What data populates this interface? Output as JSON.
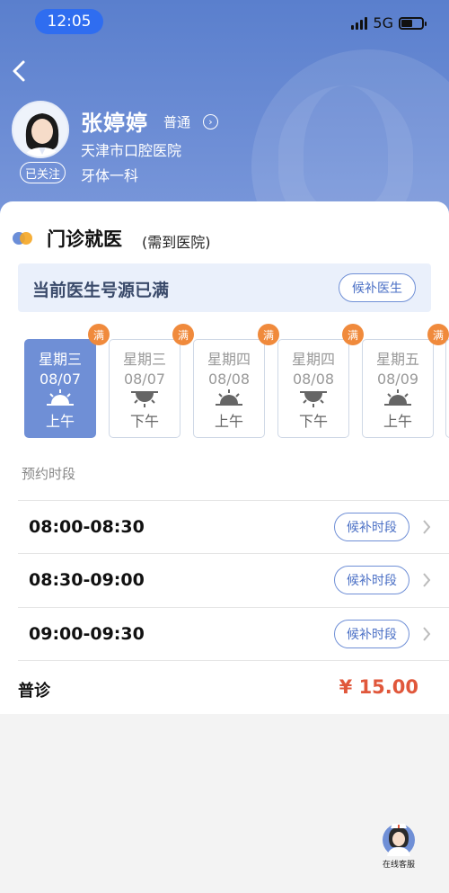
{
  "status_bar": {
    "time": "12:05",
    "network": "5G"
  },
  "doctor": {
    "name": "张婷婷",
    "title": "普通",
    "hospital": "天津市口腔医院",
    "department": "牙体一科",
    "follow_label": "已关注"
  },
  "section": {
    "title": "门诊就医",
    "note": "(需到医院)"
  },
  "banner": {
    "text": "当前医生号源已满",
    "button": "候补医生"
  },
  "full_tag": "满",
  "dates": [
    {
      "weekday": "星期三",
      "date": "08/07",
      "period": "上午",
      "active": true
    },
    {
      "weekday": "星期三",
      "date": "08/07",
      "period": "下午",
      "active": false
    },
    {
      "weekday": "星期四",
      "date": "08/08",
      "period": "上午",
      "active": false
    },
    {
      "weekday": "星期四",
      "date": "08/08",
      "period": "下午",
      "active": false
    },
    {
      "weekday": "星期五",
      "date": "08/09",
      "period": "上午",
      "active": false
    }
  ],
  "slots_label": "预约时段",
  "slots": [
    {
      "time": "08:00-08:30",
      "button": "候补时段"
    },
    {
      "time": "08:30-09:00",
      "button": "候补时段"
    },
    {
      "time": "09:00-09:30",
      "button": "候补时段"
    }
  ],
  "price": {
    "label": "普诊",
    "value": "¥ 15.00"
  },
  "customer_service": {
    "label": "在线客服"
  },
  "colors": {
    "accent": "#6f8fd6",
    "price": "#e0573b",
    "full_tag": "#f08a3c"
  }
}
